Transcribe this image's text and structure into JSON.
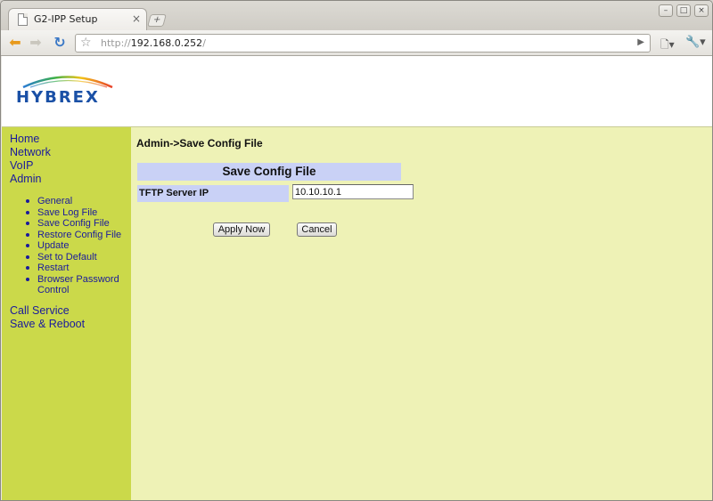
{
  "browser": {
    "tab_title": "G2-IPP Setup",
    "tab_close": "×",
    "new_tab": "+",
    "url_scheme": "http://",
    "url_host": "192.168.0.252",
    "url_path": "/",
    "icons": {
      "back": "back-arrow-icon",
      "forward": "forward-arrow-icon",
      "reload": "reload-icon",
      "bookmark": "star-icon",
      "go": "play-icon",
      "page": "page-menu-icon",
      "wrench": "wrench-icon"
    }
  },
  "header": {
    "logo_text": "HYBREX"
  },
  "sidebar": {
    "top_items": [
      "Home",
      "Network",
      "VoIP",
      "Admin"
    ],
    "admin_items": [
      "General",
      "Save Log File",
      "Save Config File",
      "Restore Config File",
      "Update",
      "Set to Default",
      "Restart",
      "Browser Password Control"
    ],
    "bottom_items": [
      "Call Service",
      "Save & Reboot"
    ]
  },
  "main": {
    "page_heading": "Admin->Save Config File",
    "section_title": "Save Config File",
    "field_label": "TFTP Server IP",
    "field_value": "10.10.10.1",
    "apply_label": "Apply Now",
    "cancel_label": "Cancel"
  },
  "colors": {
    "sidebar_bg": "#cbd94a",
    "content_bg": "#eef2b6",
    "label_bg": "#c9d1f6",
    "link": "#1a1a9c",
    "logo": "#1a50a6"
  }
}
